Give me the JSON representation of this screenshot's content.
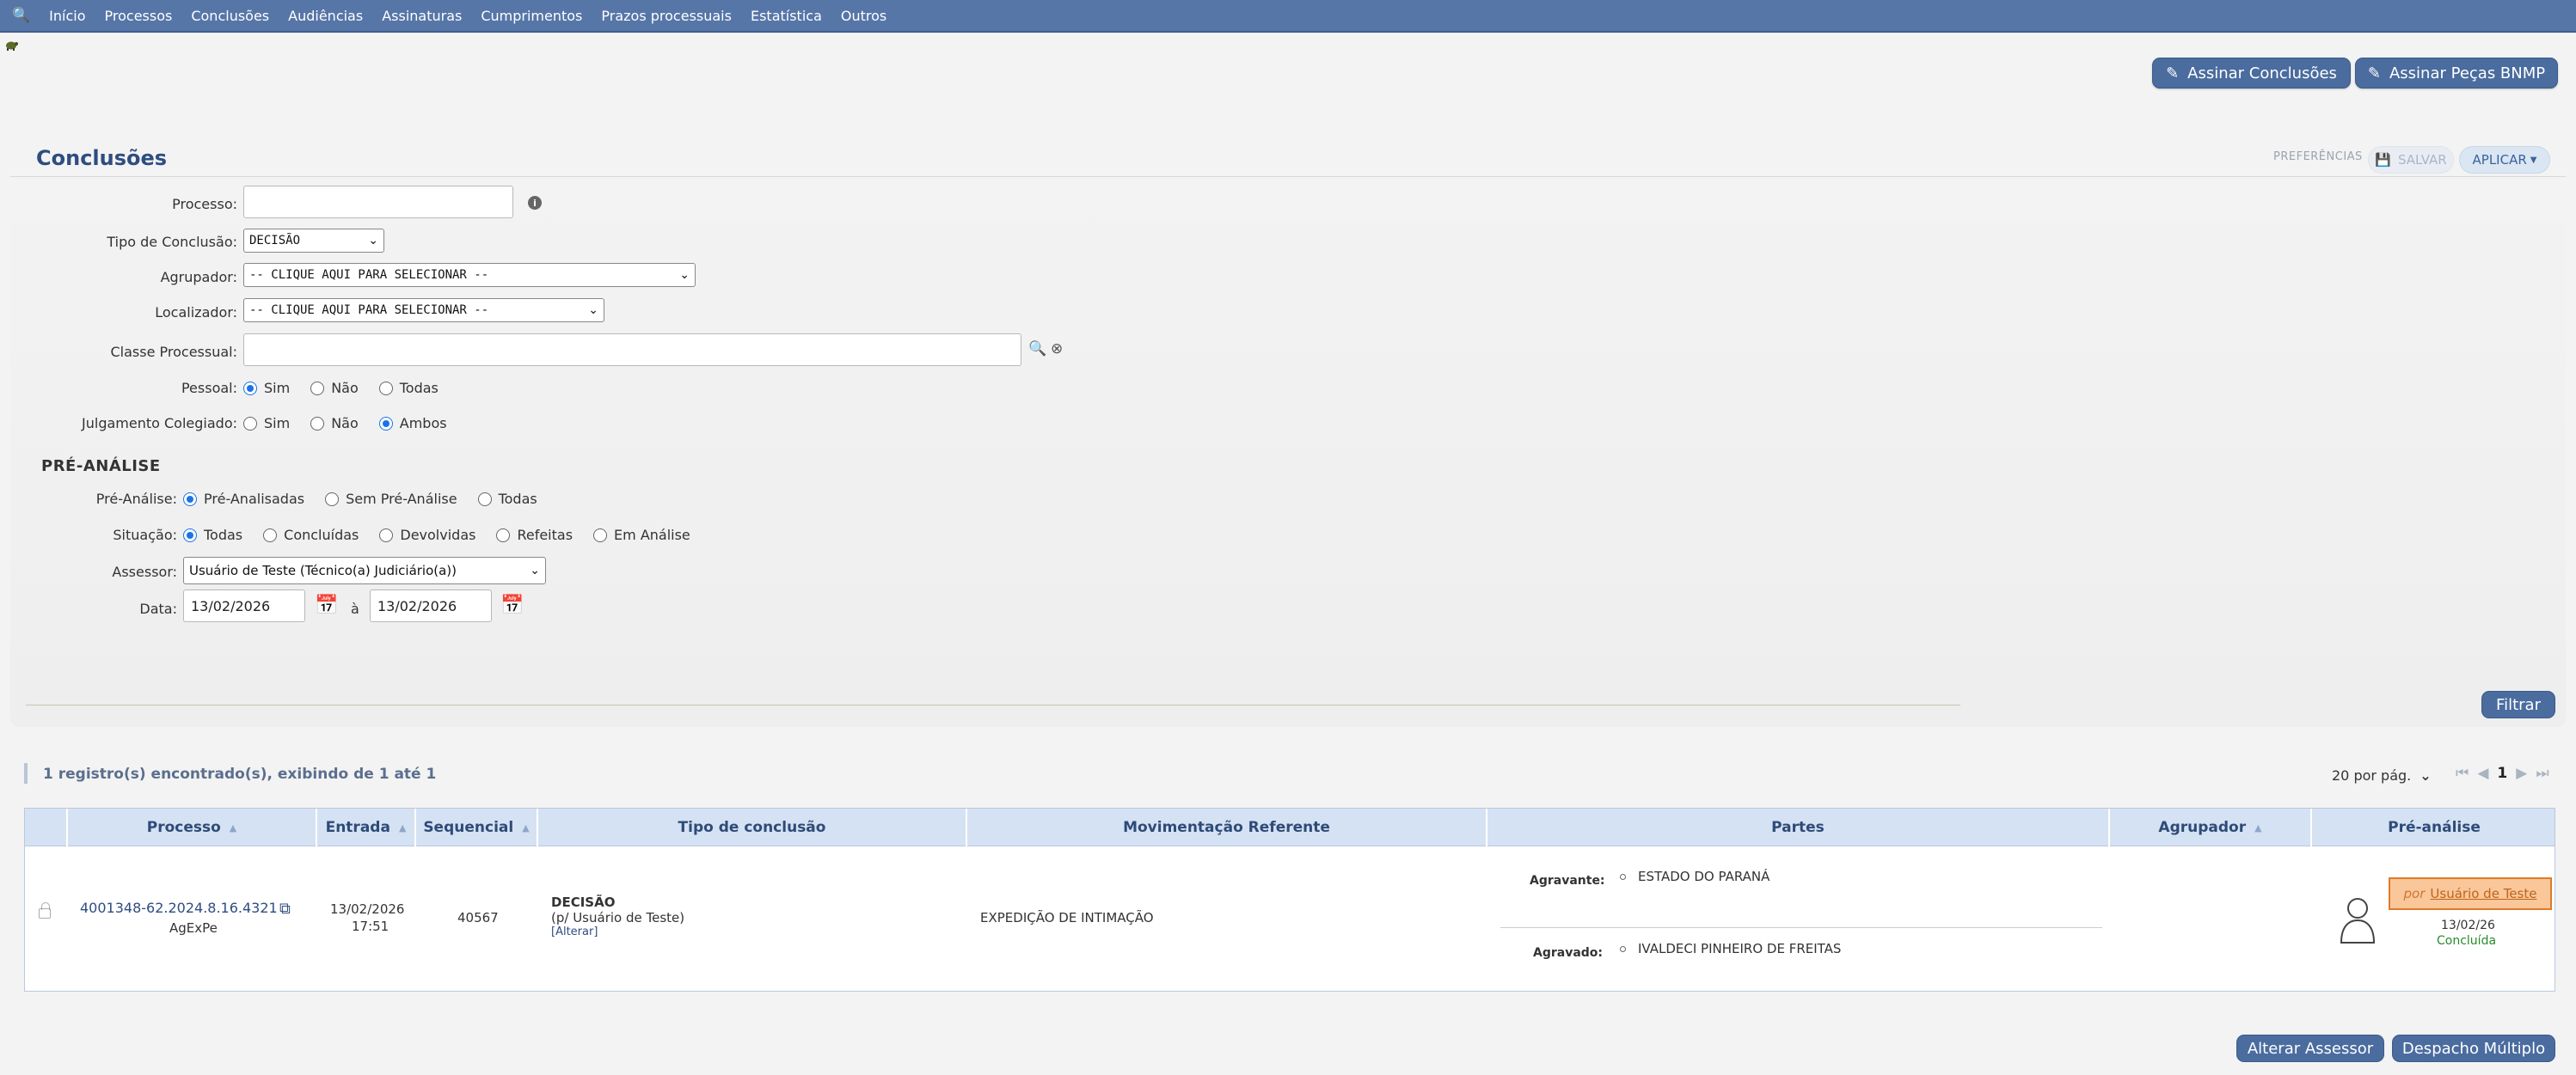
{
  "nav": {
    "items": [
      "Início",
      "Processos",
      "Conclusões",
      "Audiências",
      "Assinaturas",
      "Cumprimentos",
      "Prazos processuais",
      "Estatística",
      "Outros"
    ]
  },
  "top_buttons": {
    "assinar_conclusoes": "Assinar Conclusões",
    "assinar_pecas": "Assinar Peças BNMP"
  },
  "page": {
    "title": "Conclusões",
    "preferences_label": "PREFERÊNCIAS",
    "salvar_label": "SALVAR",
    "aplicar_label": "APLICAR"
  },
  "filter": {
    "processo_label": "Processo:",
    "processo_value": "",
    "tipo_label": "Tipo de Conclusão:",
    "tipo_value": "DECISÃO",
    "agrupador_label": "Agrupador:",
    "agrupador_value": "-- CLIQUE AQUI PARA SELECIONAR --",
    "localizador_label": "Localizador:",
    "localizador_value": "-- CLIQUE AQUI PARA SELECIONAR --",
    "classe_label": "Classe Processual:",
    "classe_value": "",
    "pessoal_label": "Pessoal:",
    "pessoal_options": [
      "Sim",
      "Não",
      "Todas"
    ],
    "pessoal_selected": "Sim",
    "julgamento_label": "Julgamento Colegiado:",
    "julgamento_options": [
      "Sim",
      "Não",
      "Ambos"
    ],
    "julgamento_selected": "Ambos",
    "pre_title": "PRÉ-ANÁLISE",
    "pre_label": "Pré-Análise:",
    "pre_options": [
      "Pré-Analisadas",
      "Sem Pré-Análise",
      "Todas"
    ],
    "pre_selected": "Pré-Analisadas",
    "situacao_label": "Situação:",
    "situacao_options": [
      "Todas",
      "Concluídas",
      "Devolvidas",
      "Refeitas",
      "Em Análise"
    ],
    "situacao_selected": "Todas",
    "assessor_label": "Assessor:",
    "assessor_value": "Usuário de Teste (Técnico(a) Judiciário(a))",
    "data_label": "Data:",
    "data_from": "13/02/2026",
    "data_sep": "à",
    "data_to": "13/02/2026",
    "filtrar_label": "Filtrar"
  },
  "results": {
    "summary": "1 registro(s) encontrado(s), exibindo de 1 até 1",
    "per_page": "20 por pág.",
    "current_page": "1",
    "columns": [
      "Processo",
      "Entrada",
      "Sequencial",
      "Tipo de conclusão",
      "Movimentação Referente",
      "Partes",
      "Agrupador",
      "Pré-análise"
    ],
    "rows": [
      {
        "processo": "4001348-62.2024.8.16.4321",
        "orgao": "AgExPe",
        "entrada_data": "13/02/2026",
        "entrada_hora": "17:51",
        "sequencial": "40567",
        "tipo": "DECISÃO",
        "tipo_usuario": "(p/ Usuário de Teste)",
        "tipo_alterar": "[Alterar]",
        "movimentacao": "EXPEDIÇÃO DE INTIMAÇÃO",
        "parte1_label": "Agravante:",
        "parte1_nome": "ESTADO DO PARANÁ",
        "parte2_label": "Agravado:",
        "parte2_nome": "IVALDECI PINHEIRO DE FREITAS",
        "pre_por": "por",
        "pre_usuario": "Usuário de Teste",
        "pre_data": "13/02/26",
        "pre_status": "Concluída"
      }
    ]
  },
  "bottom_buttons": {
    "alterar_assessor": "Alterar Assessor",
    "despacho_multiplo": "Despacho Múltiplo"
  },
  "colors": {
    "nav": "#5676a8",
    "button": "#4a6c9f",
    "table_header": "#d5e2f3",
    "badge_bg": "#f9c79a",
    "status_ok": "#2a8a2a"
  }
}
